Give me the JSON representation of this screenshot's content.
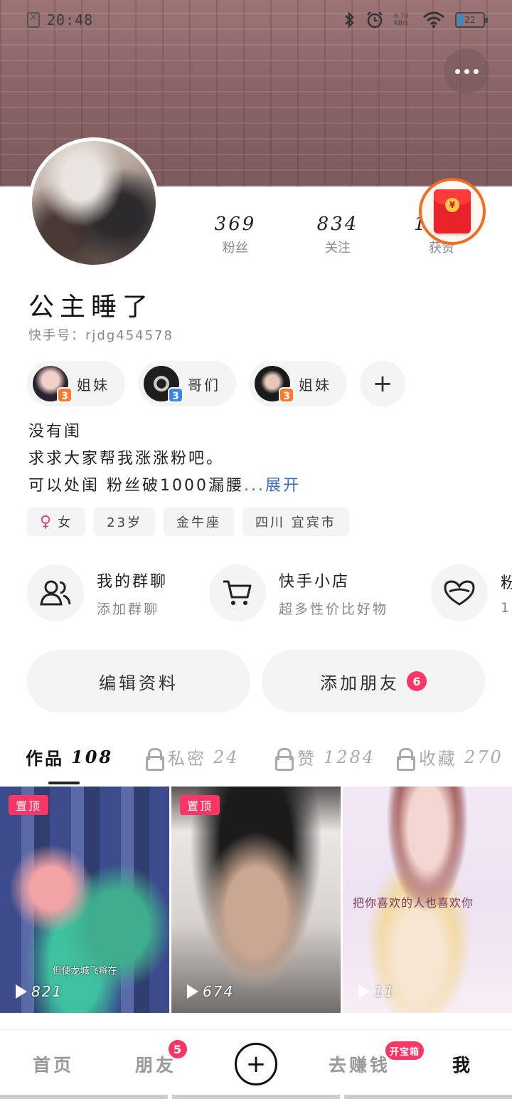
{
  "status_bar": {
    "time": "20:48",
    "net_speed": "6.70",
    "net_unit": "KB/s",
    "battery": "22"
  },
  "profile": {
    "name": "公主睡了",
    "kuaishou_id": "快手号：rjdg454578",
    "stats": [
      {
        "value": "369",
        "label": "粉丝"
      },
      {
        "value": "834",
        "label": "关注"
      },
      {
        "value": "1284",
        "label": "获赞"
      }
    ]
  },
  "relations": [
    {
      "label": "姐妹",
      "level": "3",
      "badge_color": "#ff7a2e",
      "avatar_colors": [
        "#2b2230",
        "#f0d0c8"
      ]
    },
    {
      "label": "哥们",
      "level": "3",
      "badge_color": "#3a86e8",
      "avatar_colors": [
        "#1e1e1e",
        "#cccccc"
      ]
    },
    {
      "label": "姐妹",
      "level": "3",
      "badge_color": "#ff7a2e",
      "avatar_colors": [
        "#1a1a1a",
        "#e8c8b8"
      ]
    }
  ],
  "bio": {
    "line1": "没有闺",
    "line2": "求求大家帮我涨涨粉吧。",
    "line3": "可以处闺 粉丝破1000漏腰",
    "expand": "...展开"
  },
  "tags": {
    "gender": "女",
    "age": "23岁",
    "zodiac": "金牛座",
    "location": "四川 宜宾市"
  },
  "entries": [
    {
      "title": "我的群聊",
      "subtitle": "添加群聊",
      "icon": "group-icon"
    },
    {
      "title": "快手小店",
      "subtitle": "超多性价比好物",
      "icon": "cart-icon"
    },
    {
      "title": "粉",
      "subtitle": "1",
      "icon": "heart-icon"
    }
  ],
  "actions": {
    "edit_profile": "编辑资料",
    "add_friend": "添加朋友",
    "add_friend_count": "6"
  },
  "tabs": [
    {
      "label": "作品",
      "count": "108"
    },
    {
      "label": "私密",
      "count": "24"
    },
    {
      "label": "赞",
      "count": "1284"
    },
    {
      "label": "收藏",
      "count": "270"
    }
  ],
  "works": [
    {
      "pinned_label": "置顶",
      "subtitle": "但使龙城飞将在",
      "plays": "821"
    },
    {
      "pinned_label": "置顶",
      "plays": "674"
    },
    {
      "caption": "把你喜欢的人也喜欢你",
      "plays": "11"
    }
  ],
  "bottom_nav": {
    "home": "首页",
    "friends": "朋友",
    "friends_badge": "5",
    "create": "+",
    "earn": "去赚钱",
    "earn_badge": "开宝箱",
    "me": "我"
  },
  "colors": {
    "accent": "#fe3666",
    "redpacket_ring": "#f26d22",
    "link": "#3a6bbf"
  }
}
